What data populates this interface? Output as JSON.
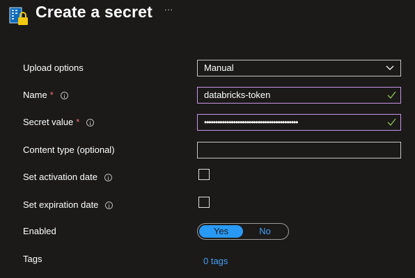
{
  "header": {
    "title": "Create a secret",
    "more_label": "···",
    "icon": "key-vault-lock-icon"
  },
  "form": {
    "upload_options": {
      "label": "Upload options",
      "value": "Manual"
    },
    "name": {
      "label": "Name",
      "required": "*",
      "value": "databricks-token"
    },
    "secret_value": {
      "label": "Secret value",
      "required": "*",
      "value": "••••••••••••••••••••••••••••••••••••••••••"
    },
    "content_type": {
      "label": "Content type (optional)",
      "value": ""
    },
    "activation_date": {
      "label": "Set activation date",
      "checked": false
    },
    "expiration_date": {
      "label": "Set expiration date",
      "checked": false
    },
    "enabled": {
      "label": "Enabled",
      "yes": "Yes",
      "no": "No",
      "selected": "Yes"
    },
    "tags": {
      "label": "Tags",
      "link": "0 tags"
    }
  },
  "colors": {
    "background": "#1b1a19",
    "accent": "#2899f5",
    "link": "#479ef5",
    "valid_border": "#c896e8",
    "valid_check": "#92c353",
    "required": "#f1707b"
  }
}
